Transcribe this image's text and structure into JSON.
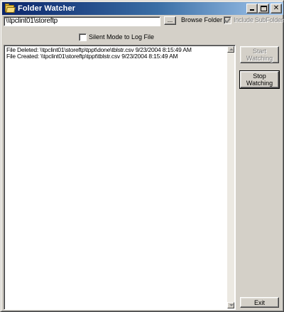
{
  "window": {
    "title": "Folder Watcher",
    "minimize_glyph": "",
    "maximize_glyph": "",
    "close_glyph": "✕"
  },
  "path_row": {
    "path_value": "\\\\tpclint01\\storeftp",
    "browse_dots_label": "...",
    "browse_label": "Browse Folder",
    "include_subfolders_label": "Include SubFolders?",
    "include_subfolders_checked": true,
    "include_subfolders_enabled": false
  },
  "silent_mode": {
    "label": "Silent Mode to Log File",
    "checked": false
  },
  "log": {
    "lines": [
      "File Deleted: \\\\tpclint01\\storeftp\\tppt\\done\\tblstr.csv 9/23/2004 8:15:49 AM",
      "File Created: \\\\tpclint01\\storeftp\\tppt\\tblstr.csv 9/23/2004 8:15:49 AM"
    ]
  },
  "buttons": {
    "start_line1": "Start",
    "start_line2": "Watching",
    "start_enabled": false,
    "stop_line1": "Stop",
    "stop_line2": "Watching",
    "exit_label": "Exit"
  },
  "colors": {
    "titlebar_start": "#0a246a",
    "titlebar_end": "#a6caf0",
    "face": "#d4d0c8",
    "disabled_text": "#808080"
  },
  "icons": {
    "title_icon": "folder-icon",
    "scroll_up": "arrow-up-icon",
    "scroll_down": "arrow-down-icon"
  }
}
